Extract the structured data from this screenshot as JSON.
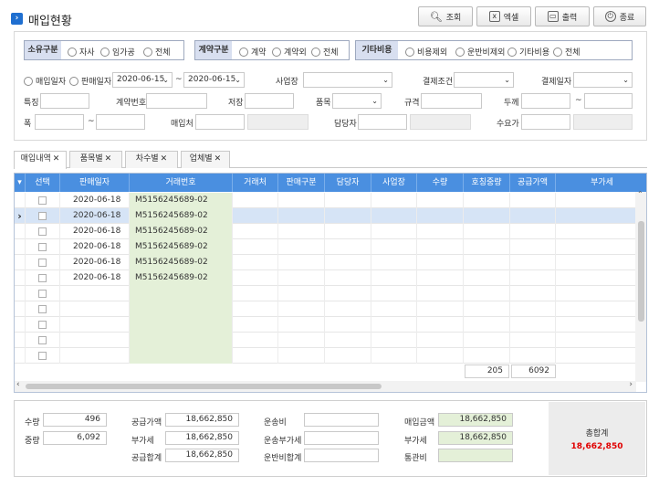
{
  "title": "매입현황",
  "toolbar": {
    "search_label": "조회",
    "excel_label": "엑셀",
    "print_label": "출력",
    "close_label": "종료"
  },
  "filters": {
    "ownership": {
      "label": "소유구분",
      "options": [
        "자사",
        "임가공",
        "전체"
      ]
    },
    "contract": {
      "label": "계약구분",
      "options": [
        "계약",
        "계약외",
        "전체"
      ]
    },
    "other_cost": {
      "label": "기타비용",
      "options": [
        "비용제외",
        "운반비제외",
        "기타비용",
        "전체"
      ]
    },
    "date_mode": [
      "매입일자",
      "판매일자"
    ],
    "date_from": "2020-06-15",
    "date_sep": "~",
    "date_to": "2020-06-15",
    "labels": {
      "workplace": "사업장",
      "payment_terms": "결제조건",
      "payment_date": "결제일자",
      "feature": "특징",
      "contract_no": "계약번호",
      "storage": "저장",
      "item": "품목",
      "spec": "규격",
      "thickness": "두께",
      "thickness_sep": "~",
      "width": "폭",
      "width_sep": "~",
      "supplier": "매입처",
      "manager": "담당자",
      "buyer": "수요가"
    }
  },
  "tabs": [
    {
      "label": "매입내역",
      "close": "✕"
    },
    {
      "label": "품목별",
      "close": "✕"
    },
    {
      "label": "차수별",
      "close": "✕"
    },
    {
      "label": "업체별",
      "close": "✕"
    }
  ],
  "grid": {
    "columns": [
      "선택",
      "판매일자",
      "거래번호",
      "거래처",
      "판매구분",
      "담당자",
      "사업장",
      "수량",
      "호칭중량",
      "공급가액",
      "부가세"
    ],
    "rows": [
      {
        "date": "2020-06-18",
        "trade_no": "M5156245689-02"
      },
      {
        "date": "2020-06-18",
        "trade_no": "M5156245689-02"
      },
      {
        "date": "2020-06-18",
        "trade_no": "M5156245689-02"
      },
      {
        "date": "2020-06-18",
        "trade_no": "M5156245689-02"
      },
      {
        "date": "2020-06-18",
        "trade_no": "M5156245689-02"
      },
      {
        "date": "2020-06-18",
        "trade_no": "M5156245689-02"
      }
    ],
    "sum_qty": "205",
    "sum_weight": "6092"
  },
  "summary": {
    "qty_label": "수량",
    "qty": "496",
    "weight_label": "중량",
    "weight": "6,092",
    "supply_label": "공급가액",
    "supply": "18,662,850",
    "vat_label": "부가세",
    "vat": "18,662,850",
    "supply_total_label": "공급합계",
    "supply_total": "18,662,850",
    "freight_label": "운송비",
    "freight": "",
    "freight_vat_label": "운송부가세",
    "freight_vat": "",
    "freight_total_label": "운반비합계",
    "freight_total": "",
    "purchase_amount_label": "매입금액",
    "purchase_amount": "18,662,850",
    "purchase_vat_label": "부가세",
    "purchase_vat": "18,662,850",
    "customs_label": "통관비",
    "customs": "",
    "grand_total_label": "총합계",
    "grand_total": "18,662,850"
  },
  "colors": {
    "header_blue": "#4a8fe0",
    "selected_row": "#d6e4f6",
    "green_cell": "#e4f0d8",
    "total_red": "#e00000"
  }
}
